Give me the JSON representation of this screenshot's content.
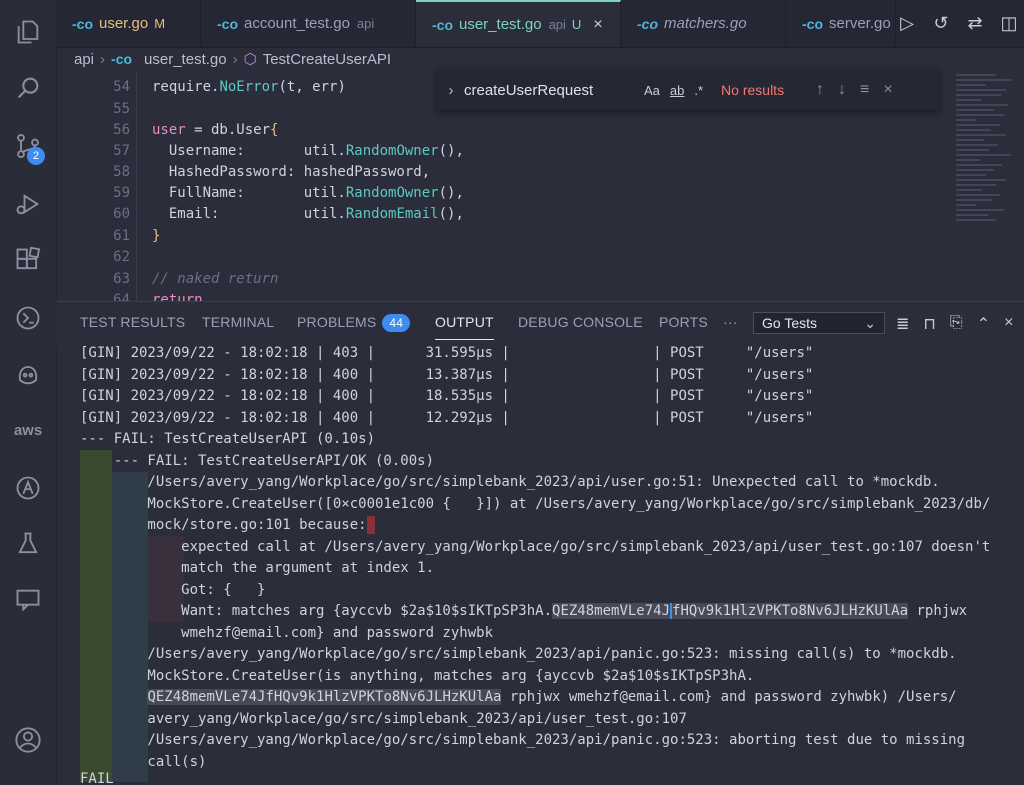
{
  "tabs": [
    {
      "name": "user.go",
      "flag": "M",
      "sub": ""
    },
    {
      "name": "account_test.go",
      "flag": "",
      "sub": "api"
    },
    {
      "name": "user_test.go",
      "flag": "U",
      "sub": "api"
    },
    {
      "name": "matchers.go",
      "flag": "",
      "sub": ""
    },
    {
      "name": "server.go",
      "flag": "",
      "sub": ""
    }
  ],
  "go_icon": "-co",
  "close_glyph": "×",
  "breadcrumb": {
    "folder": "api",
    "file": "user_test.go",
    "symbol": "TestCreateUserAPI"
  },
  "scm_badge": "2",
  "aws_label": "aws",
  "editor": {
    "lines": [
      {
        "n": "54",
        "text": "require.NoError(t, err)"
      },
      {
        "n": "55",
        "text": ""
      },
      {
        "n": "56",
        "text": "user = db.User{"
      },
      {
        "n": "57",
        "text": "  Username:       util.RandomOwner(),"
      },
      {
        "n": "58",
        "text": "  HashedPassword: hashedPassword,"
      },
      {
        "n": "59",
        "text": "  FullName:       util.RandomOwner(),"
      },
      {
        "n": "60",
        "text": "  Email:          util.RandomEmail(),"
      },
      {
        "n": "61",
        "text": "}"
      },
      {
        "n": "62",
        "text": ""
      },
      {
        "n": "63",
        "text": "// naked return"
      },
      {
        "n": "64",
        "text": "return"
      }
    ]
  },
  "find": {
    "query": "createUserRequest",
    "opt_case": "Aa",
    "opt_word": "ab",
    "opt_regex": ".*",
    "status": "No results"
  },
  "panel": {
    "tabs": [
      "TEST RESULTS",
      "TERMINAL",
      "PROBLEMS",
      "OUTPUT",
      "DEBUG CONSOLE",
      "PORTS"
    ],
    "problems_count": "44",
    "more": "···",
    "channel": "Go Tests"
  },
  "output": {
    "gin": [
      "[GIN] 2023/09/22 - 18:02:18 | 403 |      31.595µs |                 | POST     \"/users\"",
      "[GIN] 2023/09/22 - 18:02:18 | 400 |      13.387µs |                 | POST     \"/users\"",
      "[GIN] 2023/09/22 - 18:02:18 | 400 |      18.535µs |                 | POST     \"/users\"",
      "[GIN] 2023/09/22 - 18:02:18 | 400 |      12.292µs |                 | POST     \"/users\""
    ],
    "fail_api": "--- FAIL: TestCreateUserAPI (0.10s)",
    "fail_ok": "    --- FAIL: TestCreateUserAPI/OK (0.00s)",
    "l1": "        /Users/avery_yang/Workplace/go/src/simplebank_2023/api/user.go:51: Unexpected call to *mockdb.",
    "l2": "        MockStore.CreateUser([0×c0001e1c00 {   }]) at /Users/avery_yang/Workplace/go/src/simplebank_2023/db/",
    "l3": "        mock/store.go:101 because:",
    "l4": "            expected call at /Users/avery_yang/Workplace/go/src/simplebank_2023/api/user_test.go:107 doesn't",
    "l5": "            match the argument at index 1.",
    "l6": "            Got: {   }",
    "l7a": "            Want: matches arg {ayccvb $2a$10$sIKTpSP3hA.",
    "l7b": "QEZ48memVLe74J",
    "l7c": "fHQv9k1HlzVPKTo8Nv6JLHzKUlAa",
    "l7d": " rphjwx",
    "l8": "            wmehzf@email.com} and password zyhwbk",
    "l9": "        /Users/avery_yang/Workplace/go/src/simplebank_2023/api/panic.go:523: missing call(s) to *mockdb.",
    "l10": "        MockStore.CreateUser(is anything, matches arg {ayccvb $2a$10$sIKTpSP3hA.",
    "l11a": "QEZ48memVLe74JfHQv9k1HlzVPKTo8Nv6JLHzKUlAa",
    "l11b": " rphjwx wmehzf@email.com} and password zyhwbk) /Users/",
    "l12": "        avery_yang/Workplace/go/src/simplebank_2023/api/user_test.go:107",
    "l13": "        /Users/avery_yang/Workplace/go/src/simplebank_2023/api/panic.go:523: aborting test due to missing",
    "l14": "        call(s)",
    "fail": "FAIL"
  }
}
